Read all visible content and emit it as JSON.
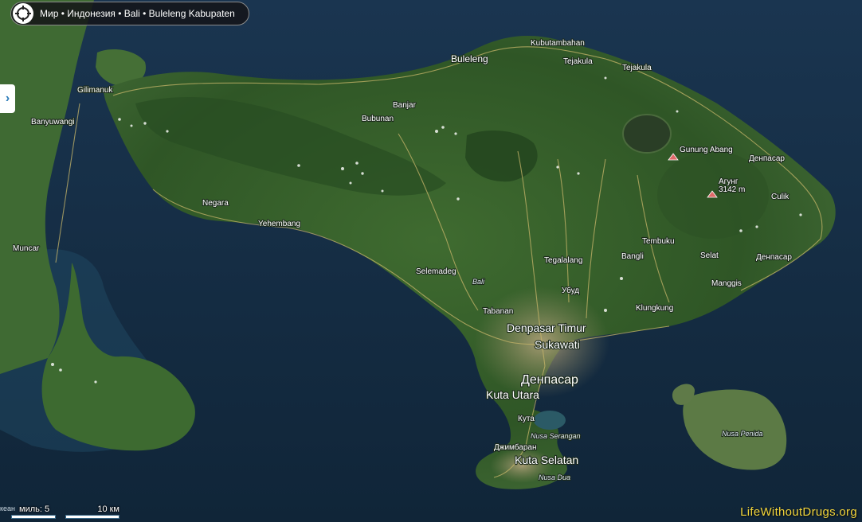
{
  "breadcrumb": {
    "text": "Мир • Индонезия • Bali • Buleleng Kabupaten"
  },
  "sidebar_toggle": {
    "glyph": "›"
  },
  "scale": {
    "miles_label": "миль: 5",
    "km_label": "10 км",
    "edge_text": "кеан"
  },
  "watermark": "LifeWithoutDrugs.org",
  "labels": {
    "buleleng": "Buleleng",
    "kubutambahan": "Kubutambahan",
    "tejakula1": "Tejakula",
    "tejakula2": "Tejakula",
    "gilimanuk": "Gilimanuk",
    "banyuwangi": "Banyuwangi",
    "banjar": "Banjar",
    "bubunan": "Bubunan",
    "gunung_abang": "Gunung Abang",
    "denpasar_ne": "Денпасар",
    "agung": "Агунг",
    "agung_height": "3142 m",
    "culik": "Culik",
    "negara": "Negara",
    "yehembang": "Yehembang",
    "muncar": "Muncar",
    "tembuku": "Tembuku",
    "selat": "Selat",
    "denpasar_e": "Денпасар",
    "tegalalang": "Tegalalang",
    "bangli": "Bangli",
    "selemadeg": "Selemadeg",
    "bali": "Bali",
    "ubud": "Убуд",
    "manggis": "Manggis",
    "tabanan": "Tabanan",
    "klungkung": "Klungkung",
    "denpasar_timur": "Denpasar Timur",
    "sukawati": "Sukawati",
    "denpasar": "Денпасар",
    "kuta_utara": "Kuta Utara",
    "kuta": "Кута",
    "nusa_serangan": "Nusa Serangan",
    "jimbaran": "Джимбаран",
    "kuta_selatan": "Kuta Selatan",
    "nusa_dua": "Nusa Dua",
    "nusa_penida": "Nusa Penida"
  }
}
